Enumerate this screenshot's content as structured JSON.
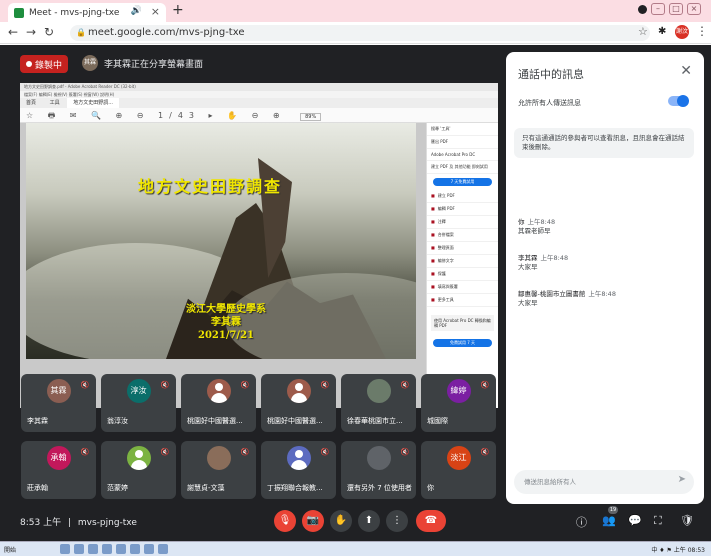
{
  "browser": {
    "tab_title": "Meet - mvs-pjng-txe",
    "url": "meet.google.com/mvs-pjng-txe",
    "profile_initial": "謝汶"
  },
  "meet": {
    "recording_label": "錄製中",
    "presenter_avatar": "其霖",
    "presenter_text": "李其霖正在分享螢幕畫面",
    "clock": "8:53 上午",
    "meeting_code": "mvs-pjng-txe",
    "participant_count": "19"
  },
  "shared_screen": {
    "tab_line": "地方文史田野調查.pdf - Adobe Acrobat Reader DC (32-bit)",
    "menu_line": "檔案(F)  編輯(E)  檢視(V)  簽署(S)  視窗(W)  說明(H)",
    "tabs": [
      "首頁",
      "工具",
      "地方文史田野調..."
    ],
    "toolbar": "☆ 🖶 ✉ 🔍   ⊕ ⊖ 1/43 ▸ ✋ ⊖ ⊕",
    "zoom": "89%",
    "slide_title": "地方文史田野調查",
    "slide_lines": [
      "淡江大學歷史學系",
      "李其霖",
      "2021/7/21"
    ],
    "panel": {
      "search": "搜尋 '工具'",
      "export": "匯出 PDF",
      "acrobat": "Adobe Acrobat Pro DC",
      "acrobat_desc": "建立 PDF 及 其他功能 即刻試用",
      "trial": "7 天免費試用",
      "items": [
        "建立 PDF",
        "編輯 PDF",
        "注釋",
        "合併檔案",
        "整理頁面",
        "編修文字",
        "保護",
        "填寫與簽署",
        "更多工具"
      ],
      "box": "使用 Acrobat Pro DC 轉換和編輯 PDF",
      "box_btn": "免費試用 7 天"
    }
  },
  "tiles": [
    {
      "name": "李其霖",
      "avatar": "其霖",
      "color": "#8b5e52",
      "type": "initials"
    },
    {
      "name": "翁淳汝",
      "avatar": "淳汝",
      "color": "#0b6e6a",
      "type": "initials"
    },
    {
      "name": "桃園好中國醫選...",
      "avatar": "",
      "color": "#9d5b4b",
      "type": "person"
    },
    {
      "name": "桃園好中國醫選...",
      "avatar": "",
      "color": "#9d5b4b",
      "type": "person"
    },
    {
      "name": "徐春華桃園市立...",
      "avatar": "",
      "color": "#6b7b6a",
      "type": "photo"
    },
    {
      "name": "城國際",
      "avatar": "緯婷",
      "color": "#7b1fa2",
      "type": "initials"
    },
    {
      "name": "莊承翰",
      "avatar": "承翰",
      "color": "#c2185b",
      "type": "initials"
    },
    {
      "name": "范蒙婷",
      "avatar": "",
      "color": "#7cb342",
      "type": "person"
    },
    {
      "name": "謝慧貞-文藻",
      "avatar": "",
      "color": "#8a6d5a",
      "type": "photo"
    },
    {
      "name": "丁振翔聯合報教...",
      "avatar": "",
      "color": "#5c6bc0",
      "type": "person"
    },
    {
      "name": "還有另外 7 位使用者",
      "avatar": "",
      "color": "#5f6368",
      "type": "group"
    },
    {
      "name": "你",
      "avatar": "淡江",
      "color": "#d84315",
      "type": "initials"
    }
  ],
  "chat": {
    "header": "通話中的訊息",
    "allow_label": "允許所有人傳送訊息",
    "note": "只有這通通話的參與者可以查看訊息，且訊息會在通話結束後刪除。",
    "messages": [
      {
        "sender": "你",
        "time": "上午8:48",
        "text": "其霖老師早"
      },
      {
        "sender": "李其霖",
        "time": "上午8:48",
        "text": "大家早"
      },
      {
        "sender": "鄒惠馨-桃園市立圖書館",
        "time": "上午8:48",
        "text": "大家早"
      }
    ],
    "input_placeholder": "傳送訊息給所有人"
  },
  "taskbar": {
    "start": "開始",
    "tray": "中 ♦ ⚑ 上午 08:53"
  },
  "colors": {
    "meet_bg": "#202124",
    "tile_bg": "#3c4043",
    "danger": "#ea4335",
    "accent": "#1a73e8"
  }
}
